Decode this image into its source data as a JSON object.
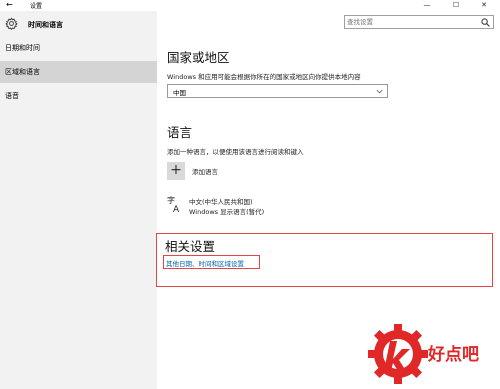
{
  "window": {
    "title": "设置",
    "back_glyph": "←",
    "minimize_glyph": "—",
    "maximize_glyph": "☐",
    "close_glyph": "✕"
  },
  "sidebar": {
    "section_title": "时间和语言",
    "section_icon": "gear-icon",
    "items": [
      {
        "label": "日期和时间",
        "active": false
      },
      {
        "label": "区域和语言",
        "active": true
      },
      {
        "label": "语音",
        "active": false
      }
    ]
  },
  "search": {
    "placeholder": "查找设置",
    "icon": "search-icon"
  },
  "region": {
    "heading": "国家或地区",
    "description": "Windows 和应用可能会根据你所在的国家或地区向你提供本地内容",
    "selected": "中国"
  },
  "language": {
    "heading": "语言",
    "description": "添加一种语言，以便使用该语言进行阅读和键入",
    "add_label": "添加语言",
    "add_glyph": "+",
    "entries": [
      {
        "name": "中文(中华人民共和国)",
        "sub": "Windows 显示语言(暂代)"
      }
    ]
  },
  "related": {
    "heading": "相关设置",
    "link": "其他日期、时间和区域设置"
  },
  "watermark": {
    "text": "好点吧"
  },
  "colors": {
    "accent_link": "#0063b1",
    "highlight_red": "#e54545",
    "sidebar_bg": "#f2f2f2",
    "active_bg": "#d4d4d4"
  }
}
